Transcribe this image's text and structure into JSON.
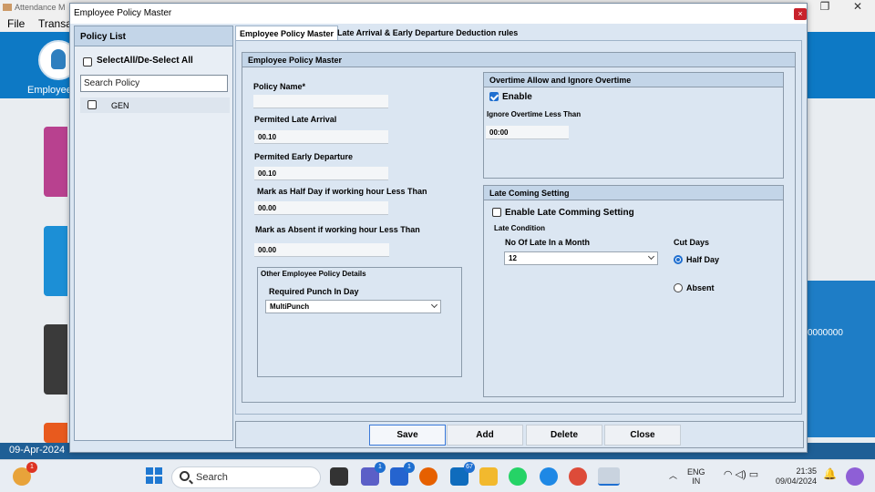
{
  "background_app": {
    "title": "Attendance M",
    "menu": [
      "File",
      "Transa"
    ],
    "ribbon_label": "Employee",
    "right_number": "0000000",
    "status_date": "09-Apr-2024"
  },
  "dialog": {
    "title": "Employee Policy Master",
    "close_glyph": "×"
  },
  "policy_list": {
    "header": "Policy List",
    "select_all_label": "SelectAll/De-Select All",
    "search_placeholder": "Search Policy",
    "items": [
      {
        "label": "GEN",
        "checked": false
      }
    ]
  },
  "tabs": [
    {
      "label": "Employee Policy Master",
      "active": true
    },
    {
      "label": "Late Arrival & Early Departure Deduction rules",
      "active": false
    }
  ],
  "policy_form": {
    "group_title": "Employee Policy Master",
    "policy_name_label": "Policy Name*",
    "policy_name_value": "",
    "late_arrival_label": "Permited Late Arrival",
    "late_arrival_value": "00.10",
    "early_departure_label": "Permited Early Departure",
    "early_departure_value": "00.10",
    "half_day_label": "Mark as Half Day if working hour Less Than",
    "half_day_value": "00.00",
    "absent_label": "Mark as Absent if working hour Less Than",
    "absent_value": "00.00",
    "other_group_title": "Other Employee Policy Details",
    "punch_label": "Required Punch In Day",
    "punch_value": "MultiPunch"
  },
  "overtime": {
    "title": "Overtime Allow and Ignore Overtime",
    "enable_label": "Enable",
    "enable_checked": true,
    "ignore_label": "Ignore Overtime Less Than",
    "ignore_value": "00:00"
  },
  "late_coming": {
    "title": "Late Coming Setting",
    "enable_label": "Enable Late Comming Setting",
    "enable_checked": false,
    "condition_label": "Late Condition",
    "no_of_late_label": "No Of Late In a Month",
    "no_of_late_value": "12",
    "cut_days_label": "Cut Days",
    "options": [
      "Half Day",
      "Absent"
    ],
    "selected_option": "Half Day"
  },
  "buttons": {
    "save": "Save",
    "add": "Add",
    "delete": "Delete",
    "close": "Close"
  },
  "taskbar": {
    "search_label": "Search",
    "badges": {
      "weather": "1",
      "teams": "1",
      "todo": "1",
      "mail": "67"
    },
    "language": [
      "ENG",
      "IN"
    ],
    "time": "21:35",
    "date": "09/04/2024"
  },
  "colors": {
    "ribbon": "#0d79c5",
    "dialog_bg": "#dbe6f2",
    "group_header": "#c3d5e8",
    "accent": "#1f6fd0",
    "close_button": "#c8222b"
  }
}
